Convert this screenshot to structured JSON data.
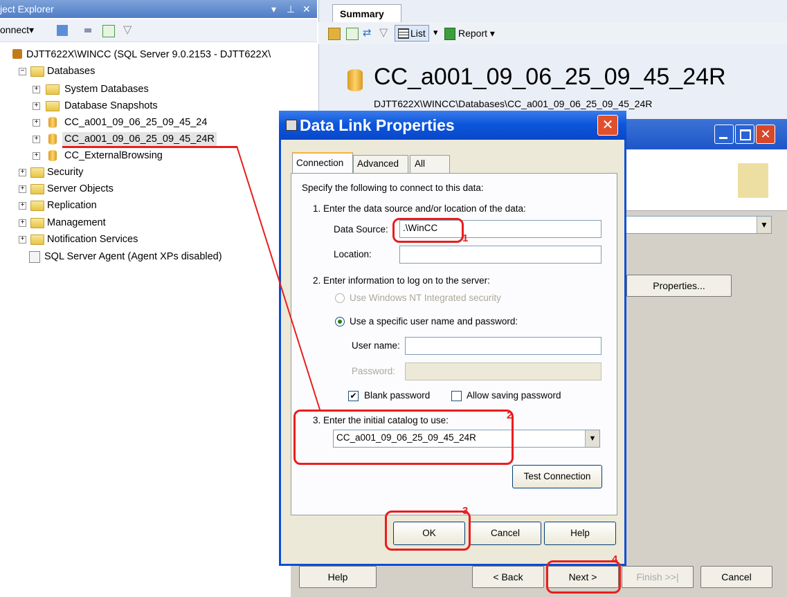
{
  "object_explorer": {
    "title": "ject Explorer",
    "connect_label": "onnect",
    "server_node": "DJTT622X\\WINCC (SQL Server 9.0.2153 - DJTT622X\\",
    "tree": [
      {
        "label": "Databases"
      },
      {
        "label": "System Databases"
      },
      {
        "label": "Database Snapshots"
      },
      {
        "label": "CC_a001_09_06_25_09_45_24"
      },
      {
        "label": "CC_a001_09_06_25_09_45_24R"
      },
      {
        "label": "CC_ExternalBrowsing"
      },
      {
        "label": "Security"
      },
      {
        "label": "Server Objects"
      },
      {
        "label": "Replication"
      },
      {
        "label": "Management"
      },
      {
        "label": "Notification Services"
      },
      {
        "label": "SQL Server Agent (Agent XPs disabled)"
      }
    ]
  },
  "summary_panel": {
    "tab_label": "Summary",
    "list_label": "List",
    "report_label": "Report",
    "db_title": "CC_a001_09_06_25_09_45_24R",
    "db_path": "DJTT622X\\WINCC\\Databases\\CC_a001_09_06_25_09_45_24R"
  },
  "wizard": {
    "properties_button": "Properties...",
    "help_button": "Help",
    "back_button": "< Back",
    "next_button": "Next >",
    "finish_button": "Finish >>|",
    "cancel_button": "Cancel"
  },
  "dialog": {
    "title": "Data Link Properties",
    "tabs": [
      "Connection",
      "Advanced",
      "All"
    ],
    "intro": "Specify the following to connect to this data:",
    "step1": "1. Enter the data source and/or location of the data:",
    "data_source_label": "Data Source:",
    "data_source_value": ".\\WinCC",
    "location_label": "Location:",
    "location_value": "",
    "step2": "2. Enter information to log on to the server:",
    "radio_nt": "Use Windows NT Integrated security",
    "radio_specific": "Use a specific user name and password:",
    "username_label": "User name:",
    "username_value": "",
    "password_label": "Password:",
    "password_value": "",
    "blank_password": "Blank password",
    "allow_saving": "Allow saving password",
    "step3": "3. Enter the initial catalog to use:",
    "catalog_value": "CC_a001_09_06_25_09_45_24R",
    "test_connection": "Test Connection",
    "ok": "OK",
    "cancel": "Cancel",
    "help": "Help"
  },
  "annotations": [
    "1",
    "2",
    "3",
    "4"
  ],
  "colors": {
    "annotation_red": "#e81d1d",
    "title_blue": "#0d57dc"
  }
}
